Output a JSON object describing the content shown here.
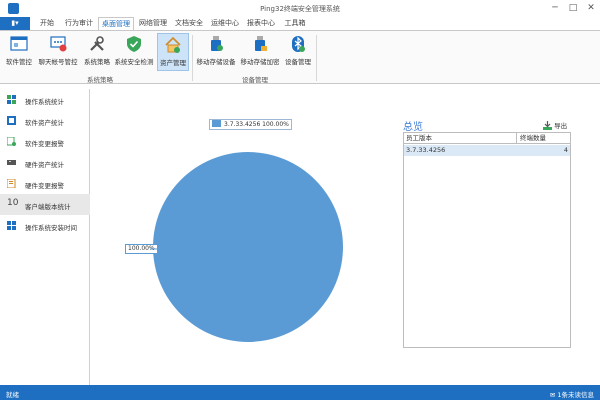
{
  "window": {
    "title": "Ping32终端安全管理系统",
    "menu_button": "▮▾"
  },
  "tabs": [
    {
      "label": "开始"
    },
    {
      "label": "行为审计"
    },
    {
      "label": "桌面管理"
    },
    {
      "label": "网络管理"
    },
    {
      "label": "文档安全"
    },
    {
      "label": "运维中心"
    },
    {
      "label": "报表中心"
    },
    {
      "label": "工具箱"
    }
  ],
  "ribbon": {
    "buttons": [
      {
        "label": "软件管控"
      },
      {
        "label": "聊天帐号管控"
      },
      {
        "label": "系统策略"
      },
      {
        "label": "系统安全检测"
      },
      {
        "label": "资产管理"
      },
      {
        "label": "移动存储设备"
      },
      {
        "label": "移动存储加密"
      },
      {
        "label": "设备管理"
      }
    ],
    "groups": [
      {
        "label": "系统策略"
      },
      {
        "label": "设备管理"
      }
    ]
  },
  "sidebar": {
    "items": [
      {
        "label": "操作系统统计"
      },
      {
        "label": "软件资产统计"
      },
      {
        "label": "软件变更报警"
      },
      {
        "label": "硬件资产统计"
      },
      {
        "label": "硬件变更报警"
      },
      {
        "label": "客户端版本统计",
        "prefix": "10"
      },
      {
        "label": "操作系统安装时间"
      }
    ]
  },
  "chart_data": {
    "type": "pie",
    "slices": [
      {
        "label": "3.7.33.4256",
        "value": 100.0,
        "percent_label": "100.00%",
        "color": "#5b9bd5"
      }
    ],
    "legend_text": "3.7.33.4256  100.00%"
  },
  "overview": {
    "title": "总览",
    "export_label": "导出",
    "columns": [
      "员工版本",
      "终端数量"
    ],
    "rows": [
      {
        "version": "3.7.33.4256",
        "count": "4"
      }
    ]
  },
  "statusbar": {
    "left": "就绪",
    "right": "1条未读信息"
  },
  "colors": {
    "accent": "#1e6fc2",
    "pie": "#5b9bd5"
  }
}
